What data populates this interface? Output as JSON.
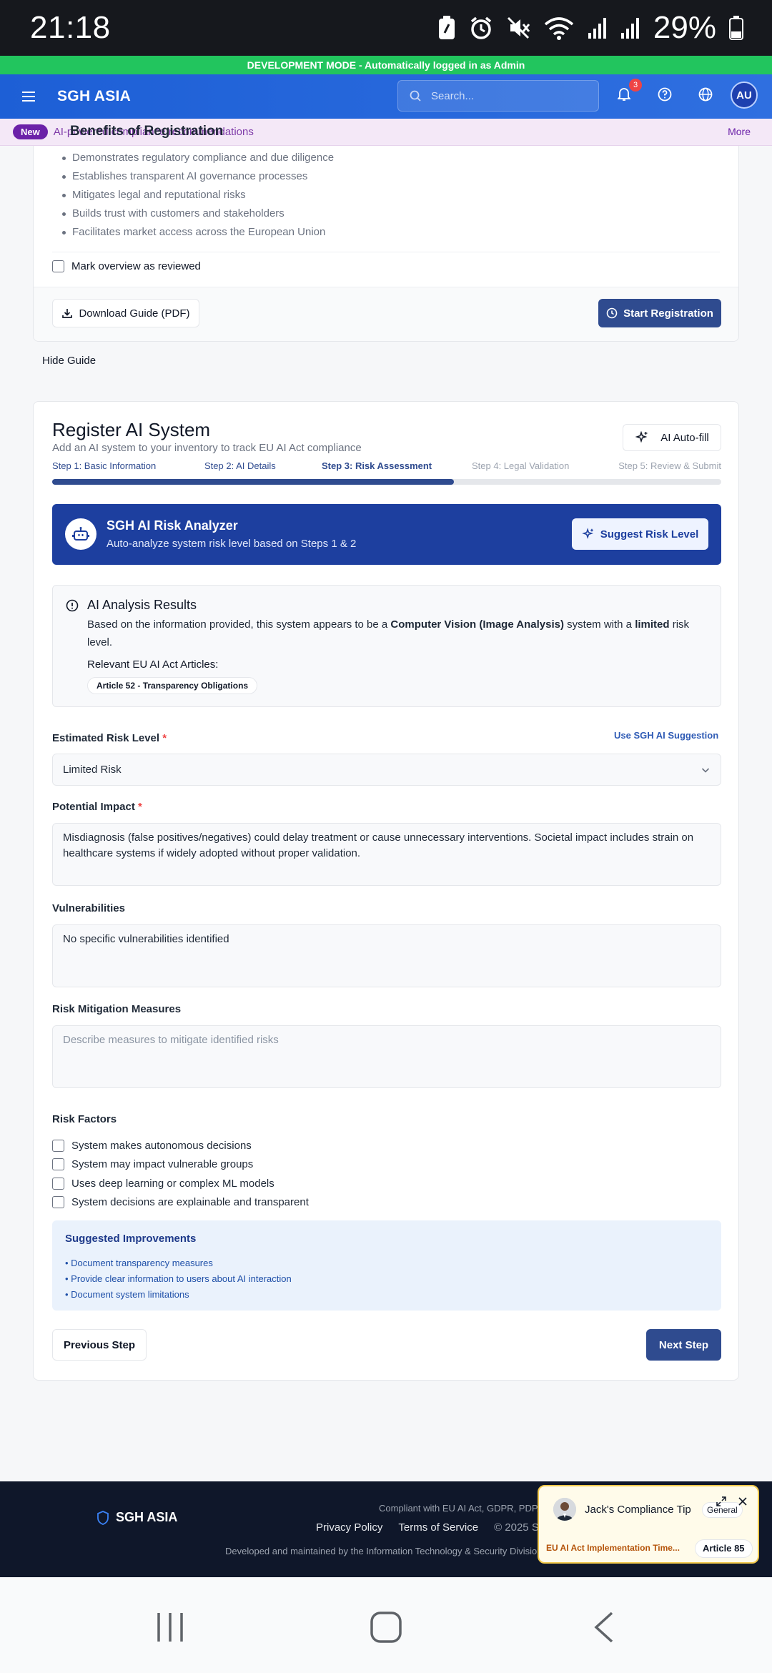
{
  "status_bar": {
    "time": "21:18",
    "battery": "29%"
  },
  "dev_banner": "DEVELOPMENT MODE - Automatically logged in as Admin",
  "topnav": {
    "brand": "SGH ASIA",
    "search_placeholder": "Search...",
    "notification_count": "3",
    "avatar": "AU"
  },
  "announcement": {
    "badge": "New",
    "text": "AI-powered compliance recommendations",
    "overlay_heading": "Benefits of Registration",
    "more": "More"
  },
  "guide": {
    "benefits": [
      "Demonstrates regulatory compliance and due diligence",
      "Establishes transparent AI governance processes",
      "Mitigates legal and reputational risks",
      "Builds trust with customers and stakeholders",
      "Facilitates market access across the European Union"
    ],
    "reviewed_label": "Mark overview as reviewed",
    "download_label": "Download Guide (PDF)",
    "start_label": "Start Registration",
    "hide_label": "Hide Guide"
  },
  "register": {
    "title": "Register AI System",
    "subtitle": "Add an AI system to your inventory to track EU AI Act compliance",
    "autofill_label": "AI Auto-fill",
    "steps": [
      "Step 1: Basic Information",
      "Step 2: AI Details",
      "Step 3: Risk Assessment",
      "Step 4: Legal Validation",
      "Step 5: Review & Submit"
    ],
    "current_step": 3,
    "progress_fraction": 0.6,
    "analyzer": {
      "title": "SGH AI Risk Analyzer",
      "subtitle": "Auto-analyze system risk level based on Steps 1 & 2",
      "button": "Suggest Risk Level"
    },
    "results": {
      "heading": "AI Analysis Results",
      "text_prefix": "Based on the information provided, this system appears to be a ",
      "system_type": "Computer Vision (Image Analysis)",
      "text_middle": " system with a ",
      "risk_word": "limited",
      "text_suffix": " risk level.",
      "articles_label": "Relevant EU AI Act Articles:",
      "article_chip": "Article 52 - Transparency Obligations"
    },
    "risk_level": {
      "label": "Estimated Risk Level",
      "required_mark": "*",
      "suggestion_link": "Use SGH AI Suggestion",
      "value": "Limited Risk"
    },
    "potential_impact": {
      "label": "Potential Impact",
      "required_mark": "*",
      "value": "Misdiagnosis (false positives/negatives) could delay treatment or cause unnecessary interventions. Societal impact includes strain on healthcare systems if widely adopted without proper validation."
    },
    "vulnerabilities": {
      "label": "Vulnerabilities",
      "value": "No specific vulnerabilities identified"
    },
    "mitigation": {
      "label": "Risk Mitigation Measures",
      "placeholder": "Describe measures to mitigate identified risks"
    },
    "risk_factors": {
      "label": "Risk Factors",
      "items": [
        "System makes autonomous decisions",
        "System may impact vulnerable groups",
        "Uses deep learning or complex ML models",
        "System decisions are explainable and transparent"
      ]
    },
    "improvements": {
      "heading": "Suggested Improvements",
      "items": [
        "• Document transparency measures",
        "• Provide clear information to users about AI interaction",
        "• Document system limitations"
      ]
    },
    "prev_label": "Previous Step",
    "next_label": "Next Step"
  },
  "footer": {
    "brand": "SGH ASIA",
    "compliance": "Compliant with EU AI Act, GDPR, PDPA",
    "privacy": "Privacy Policy",
    "terms": "Terms of Service",
    "copyright": "© 2025 S",
    "developed": "Developed and maintained by the Information Technology & Security Divisio"
  },
  "tip": {
    "name": "Jack's Compliance Tip",
    "category": "General",
    "headline": "EU AI Act Implementation Time...",
    "article": "Article 85"
  },
  "colors": {
    "primary": "#2f4b8f",
    "analyzer": "#1d3f9f",
    "nav": "#1d5fd6",
    "dev": "#22c55e",
    "required": "#ef4444"
  }
}
